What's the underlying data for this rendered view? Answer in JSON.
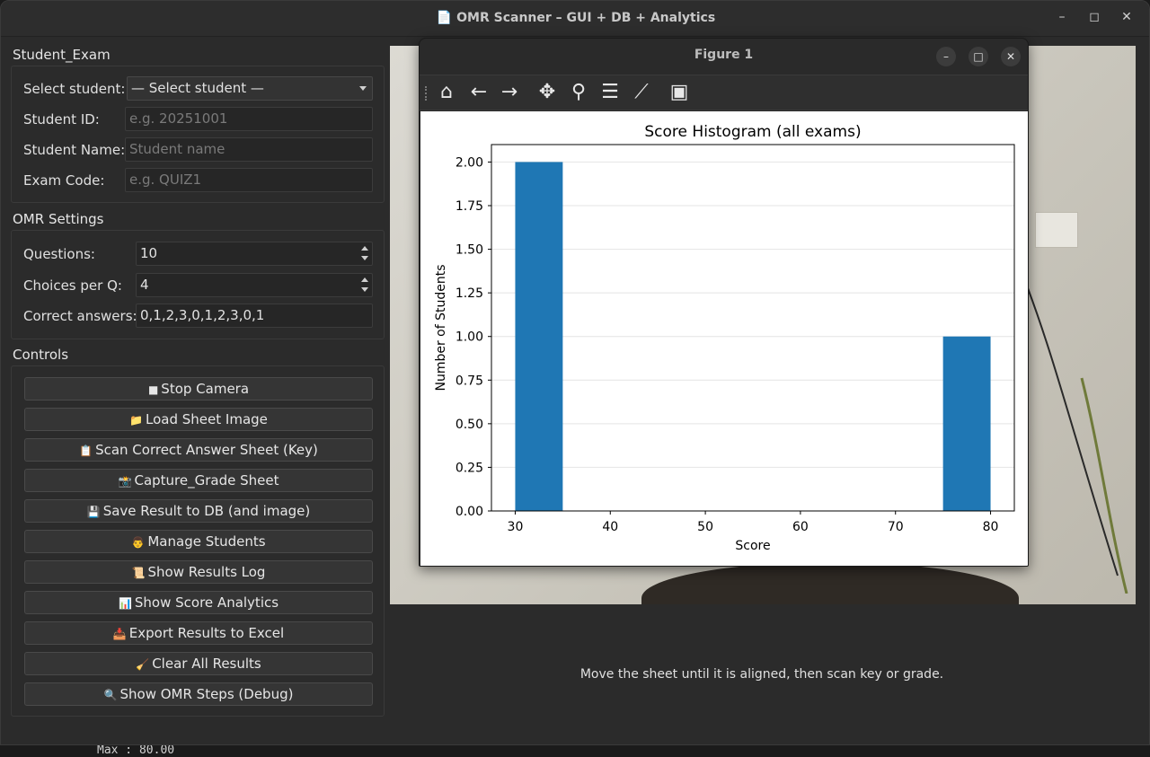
{
  "window": {
    "title": "📄 OMR Scanner – GUI + DB + Analytics"
  },
  "student_exam": {
    "title": "Student_Exam",
    "select_label": "Select student:",
    "select_value": "— Select student —",
    "id_label": "Student ID:",
    "id_placeholder": "e.g. 20251001",
    "name_label": "Student Name:",
    "name_placeholder": "Student name",
    "exam_label": "Exam Code:",
    "exam_placeholder": "e.g. QUIZ1"
  },
  "omr_settings": {
    "title": "OMR Settings",
    "questions_label": "Questions:",
    "questions_value": "10",
    "choices_label": "Choices per Q:",
    "choices_value": "4",
    "answers_label": "Correct answers:",
    "answers_value": "0,1,2,3,0,1,2,3,0,1"
  },
  "controls": {
    "title": "Controls",
    "buttons": [
      {
        "icon": "■",
        "label": "Stop Camera"
      },
      {
        "icon": "📁",
        "label": "Load Sheet Image"
      },
      {
        "icon": "📋",
        "label": "Scan Correct Answer Sheet (Key)"
      },
      {
        "icon": "📸",
        "label": "Capture_Grade Sheet"
      },
      {
        "icon": "💾",
        "label": "Save Result to DB (and image)"
      },
      {
        "icon": "👨",
        "label": "Manage Students"
      },
      {
        "icon": "📜",
        "label": "Show Results Log"
      },
      {
        "icon": "📊",
        "label": "Show Score Analytics"
      },
      {
        "icon": "📥",
        "label": "Export Results to Excel"
      },
      {
        "icon": "🧹",
        "label": "Clear All Results"
      },
      {
        "icon": "🔍",
        "label": "Show OMR Steps (Debug)"
      }
    ]
  },
  "status": {
    "text": "Move the sheet until it is aligned, then scan key or grade."
  },
  "figure": {
    "title": "Figure 1",
    "toolbar_icons": [
      "home-icon",
      "back-icon",
      "forward-icon",
      "pan-icon",
      "zoom-icon",
      "configure-icon",
      "edit-axes-icon",
      "save-icon"
    ]
  },
  "chart_data": {
    "type": "bar",
    "title": "Score Histogram (all exams)",
    "xlabel": "Score",
    "ylabel": "Number of Students",
    "bins": [
      {
        "x0": 30,
        "x1": 35,
        "value": 2
      },
      {
        "x0": 75,
        "x1": 80,
        "value": 1
      }
    ],
    "xlim": [
      27.5,
      82.5
    ],
    "ylim": [
      0,
      2.1
    ],
    "xticks": [
      30,
      40,
      50,
      60,
      70,
      80
    ],
    "yticks": [
      "0.00",
      "0.25",
      "0.50",
      "0.75",
      "1.00",
      "1.25",
      "1.50",
      "1.75",
      "2.00"
    ],
    "ytick_values": [
      0,
      0.25,
      0.5,
      0.75,
      1.0,
      1.25,
      1.5,
      1.75,
      2.0
    ],
    "bar_color": "#1f77b4",
    "grid": "y"
  },
  "terminal_residual": {
    "text": "Max   : 80.00"
  }
}
